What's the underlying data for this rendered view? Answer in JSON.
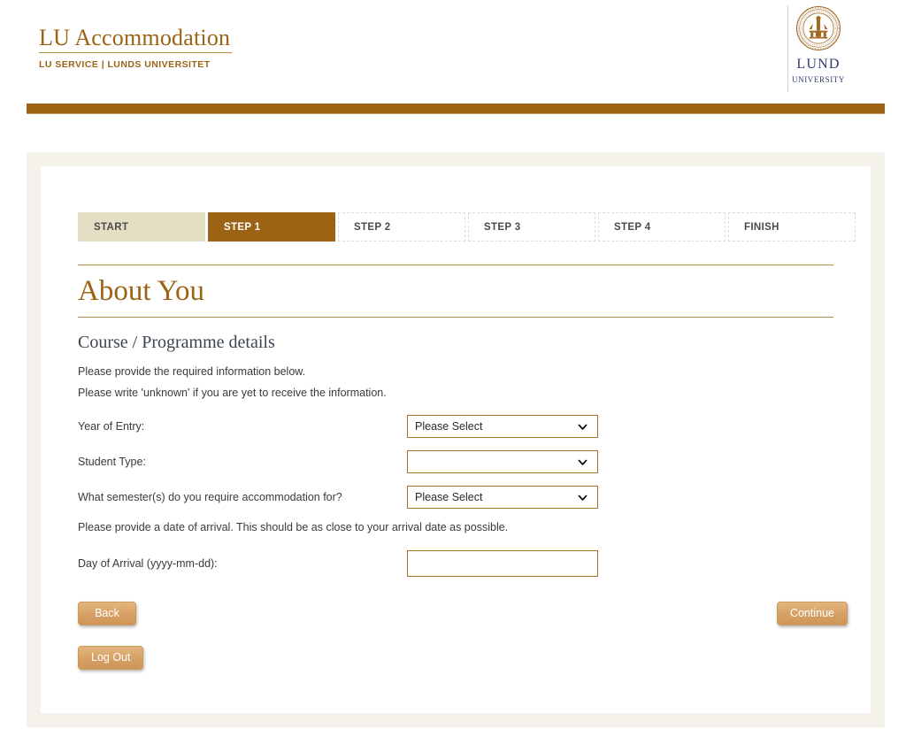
{
  "header": {
    "brand_title": "LU Accommodation",
    "brand_subtitle": "LU SERVICE | LUNDS UNIVERSITET",
    "logo_line1": "LUND",
    "logo_line2": "UNIVERSITY",
    "accent_color": "#9c6315",
    "logo_text_color": "#2e3e6b",
    "bar_color": "#9c6315"
  },
  "steps": [
    {
      "label": "START",
      "state": "completed"
    },
    {
      "label": "STEP 1",
      "state": "active"
    },
    {
      "label": "STEP 2",
      "state": "upcoming"
    },
    {
      "label": "STEP 3",
      "state": "upcoming"
    },
    {
      "label": "STEP 4",
      "state": "upcoming"
    },
    {
      "label": "FINISH",
      "state": "upcoming"
    }
  ],
  "main": {
    "page_title": "About You",
    "section_title": "Course / Programme details",
    "note_1": "Please provide the required information below.",
    "note_2": "Please write 'unknown' if you are yet to receive the information.",
    "note_3": "Please provide a date of arrival. This should be as close to your arrival date as possible."
  },
  "form": {
    "year_of_entry": {
      "label": "Year of Entry:",
      "value": "Please Select"
    },
    "student_type": {
      "label": "Student Type:",
      "value": ""
    },
    "semesters": {
      "label": "What semester(s) do you require accommodation for?",
      "value": "Please Select"
    },
    "day_of_arrival": {
      "label": "Day of Arrival (yyyy-mm-dd):",
      "value": "",
      "placeholder": ""
    }
  },
  "buttons": {
    "back": "Back",
    "continue": "Continue",
    "log_out": "Log Out"
  }
}
